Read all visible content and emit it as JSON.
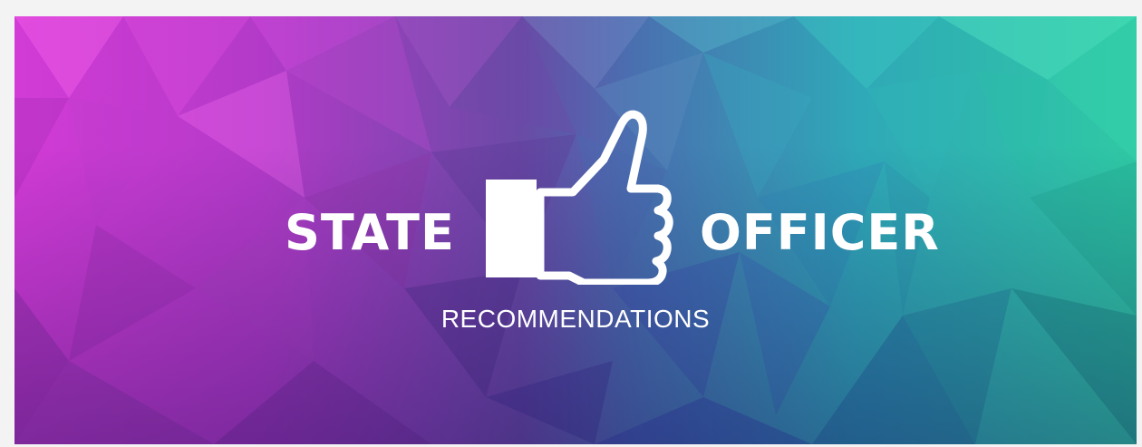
{
  "banner": {
    "title_left": "STATE",
    "title_right": "OFFICER",
    "subtitle": "RECOMMENDATIONS",
    "icon": "thumbs-up-icon",
    "colors": {
      "magenta": "#d23bd6",
      "purple": "#6a4aa6",
      "blue": "#3d57b8",
      "teal": "#2fa8b8",
      "green": "#2fc9a4",
      "text": "#ffffff"
    }
  }
}
